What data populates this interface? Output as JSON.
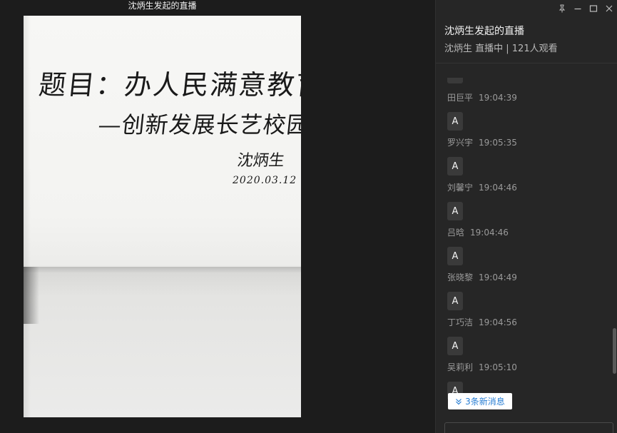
{
  "window": {
    "video_title": "沈炳生发起的直播"
  },
  "video": {
    "handwriting_line1": "题目：办人民满意教育",
    "handwriting_line2": "—创新发展长艺校园文化",
    "handwriting_signature": "沈炳生",
    "handwriting_date": "2020.03.12"
  },
  "panel": {
    "title": "沈炳生发起的直播",
    "subtitle": "沈炳生 直播中 | 121人观看",
    "controls": [
      "pin-icon",
      "minimize-icon",
      "maximize-icon",
      "close-icon"
    ]
  },
  "chat": {
    "messages": [
      {
        "name": "田巨平",
        "time": "19:04:39",
        "text": "A"
      },
      {
        "name": "罗兴宇",
        "time": "19:05:35",
        "text": "A"
      },
      {
        "name": "刘馨宁",
        "time": "19:04:46",
        "text": "A"
      },
      {
        "name": "吕晗",
        "time": "19:04:46",
        "text": "A"
      },
      {
        "name": "张晓黎",
        "time": "19:04:49",
        "text": "A"
      },
      {
        "name": "丁巧洁",
        "time": "19:04:56",
        "text": "A"
      },
      {
        "name": "吴莉利",
        "time": "19:05:10",
        "text": "A"
      }
    ],
    "new_messages_label": "3条新消息"
  },
  "colors": {
    "background": "#1c1c1c",
    "panel": "#262626",
    "accent": "#2a7fd4"
  }
}
